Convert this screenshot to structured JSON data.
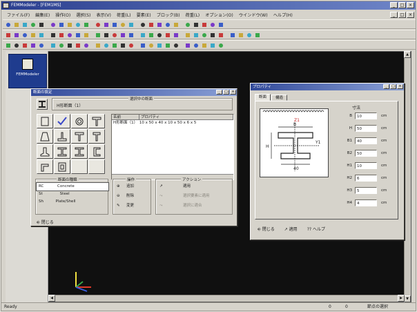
{
  "window": {
    "title": "FEMModeler - [FEM1MS]",
    "min": "_",
    "max": "□",
    "close": "×"
  },
  "menu": [
    "ファイル(F)",
    "編集(E)",
    "操作(O)",
    "選択(S)",
    "表示(V)",
    "荷重(L)",
    "要素(E)",
    "ブロック(B)",
    "荷重(L)",
    "オプション(O)",
    "ウインドウ(W)",
    "ヘルプ(H)"
  ],
  "side_panel": {
    "modeler_label": "FEMModeler"
  },
  "section_dialog": {
    "title": "断面の設定",
    "current_group_label": "選択中の断面",
    "current_value": "H形断面（1）",
    "list_headers": [
      "名前",
      "プロパティ"
    ],
    "list_rows": [
      "H形断面（1）　10 x 50 x 40 x 10 x 50 x 6 x 5"
    ],
    "material_group_label": "断面の種類",
    "materials": [
      {
        "code": "RC",
        "name": "Concrete"
      },
      {
        "code": "St",
        "name": "Steel"
      },
      {
        "code": "Sh",
        "name": "Plate/Shell"
      }
    ],
    "ops_group_label": "操作",
    "ops": [
      "追加",
      "削除",
      "変更"
    ],
    "actions_group_label": "アクション",
    "actions": [
      "適用",
      "選択要素に適用",
      "選択に適合"
    ],
    "close_label": "閉じる"
  },
  "property_dialog": {
    "title": "プロパティ",
    "tabs": [
      "断面",
      "構造"
    ],
    "drawing_labels": {
      "top": "B",
      "web": "t",
      "height": "H",
      "yaxis": "Y1",
      "base": "40"
    },
    "dims": [
      {
        "label": "B",
        "value": "10",
        "unit": "cm"
      },
      {
        "label": "H",
        "value": "50",
        "unit": "cm"
      },
      {
        "label": "B1",
        "value": "40",
        "unit": "cm"
      },
      {
        "label": "B2",
        "value": "50",
        "unit": "cm"
      },
      {
        "label": "H1",
        "value": "10",
        "unit": "cm"
      },
      {
        "label": "H2",
        "value": "6",
        "unit": "cm"
      },
      {
        "label": "H3",
        "value": "5",
        "unit": "cm"
      },
      {
        "label": "H4",
        "value": "4",
        "unit": "cm"
      }
    ],
    "dims_title": "寸法",
    "buttons": [
      "閉じる",
      "適用",
      "ヘルプ"
    ]
  },
  "status": {
    "left": "Ready",
    "coord1": "0",
    "coord2": "0",
    "mode": "節点の選択"
  },
  "colors": {
    "title_bar": "#2b3f8f",
    "canvas": "#101010",
    "modeler_button": "#1f3c8e"
  }
}
